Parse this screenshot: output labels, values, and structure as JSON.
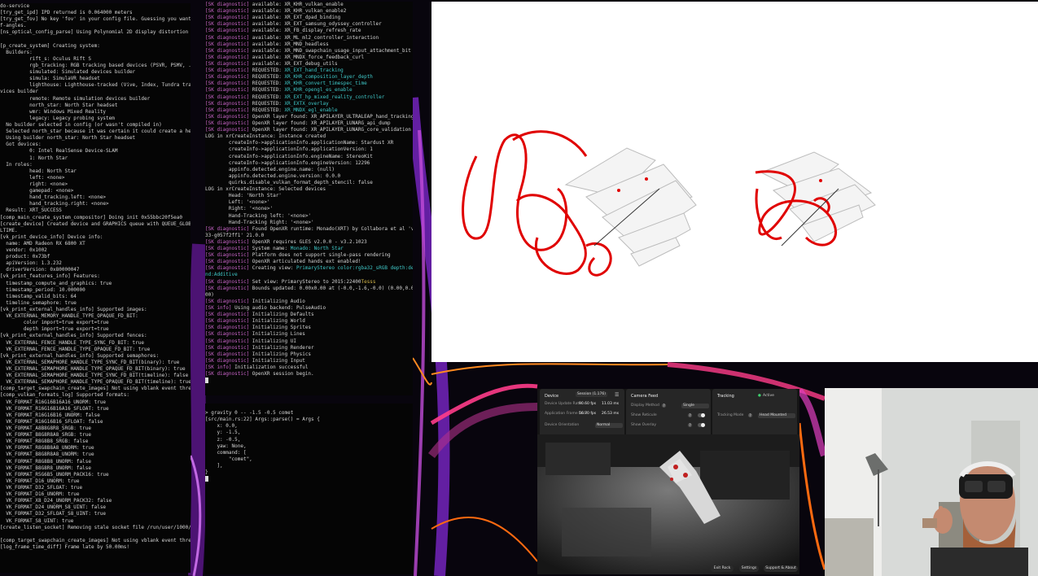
{
  "terminal_left": {
    "lines": [
      "do-service",
      "[try_get_ipd] IPD returned is 0.064000 meters",
      "[try_get_fov] No key 'fov' in your config file. Guessing you want 0.7 radi",
      "f-angles.",
      "[ns_optical_config_parse] Using Polynomial 2D display distortion correctio",
      "",
      "[p_create_system] Creating system:",
      "  Builders:",
      "          rift_s: Oculus Rift S",
      "          rgb_tracking: RGB tracking based devices (PSVR, PSMV, ...)",
      "          simulated: Simulated devices builder",
      "          simula: SimulaVR headset",
      "          lighthouse: Lighthouse-tracked (Vive, Index, Tundra trackers, et",
      "vices builder",
      "          remote: Remote simulation devices builder",
      "          north_star: North Star headset",
      "          wmr: Windows Mixed Reality",
      "          legacy: Legacy probing system",
      "  No builder selected in config (or wasn't compiled in)",
      "  Selected north_star because it was certain it could create a head",
      "  Using builder north_star: North Star headset",
      "  Got devices:",
      "          0: Intel RealSense Device-SLAM",
      "          1: North Star",
      "  In roles:",
      "          head: North Star",
      "          left: <none>",
      "          right: <none>",
      "          gamepad: <none>",
      "          hand_tracking.left: <none>",
      "          hand_tracking.right: <none>",
      "  Result: XRT_SUCCESS",
      "[comp_main_create_system_compositor] Doing init 0x55bbc20f5ea0",
      "[create_device] Created device and GRAPHICS queue with QUEUE_GLOBAL_PRIORI",
      "LTIME.",
      "[vk_print_device_info] Device info:",
      "  name: AMD Radeon RX 6800 XT",
      "  vendor: 0x1002",
      "  product: 0x73bf",
      "  apiVersion: 1.3.232",
      "  driverVersion: 0x80000047",
      "[vk_print_features_info] Features:",
      "  timestamp_compute_and_graphics: true",
      "  timestamp_period: 10.000000",
      "  timestamp_valid_bits: 64",
      "  timeline_semaphore: true",
      "[vk_print_external_handles_info] Supported images:",
      "  VK_EXTERNAL_MEMORY_HANDLE_TYPE_OPAQUE_FD_BIT:",
      "        color import=true export=true",
      "        depth import=true export=true",
      "[vk_print_external_handles_info] Supported fences:",
      "  VK_EXTERNAL_FENCE_HANDLE_TYPE_SYNC_FD_BIT: true",
      "  VK_EXTERNAL_FENCE_HANDLE_TYPE_OPAQUE_FD_BIT: true",
      "[vk_print_external_handles_info] Supported semaphores:",
      "  VK_EXTERNAL_SEMAPHORE_HANDLE_TYPE_SYNC_FD_BIT(binary): true",
      "  VK_EXTERNAL_SEMAPHORE_HANDLE_TYPE_OPAQUE_FD_BIT(binary): true",
      "  VK_EXTERNAL_SEMAPHORE_HANDLE_TYPE_SYNC_FD_BIT(timeline): false",
      "  VK_EXTERNAL_SEMAPHORE_HANDLE_TYPE_OPAQUE_FD_BIT(timeline): true",
      "[comp_target_swapchain_create_images] Not using vblank event thread!",
      "[comp_vulkan_formats_log] Supported formats:",
      "  VK_FORMAT_R16G16B16A16_UNORM: true",
      "  VK_FORMAT_R16G16B16A16_SFLOAT: true",
      "  VK_FORMAT_R16G16B16_UNORM: false",
      "  VK_FORMAT_R16G16B16_SFLOAT: false",
      "  VK_FORMAT_A8B8G8R8_SRGB: true",
      "  VK_FORMAT_B8G8R8A8_SRGB: true",
      "  VK_FORMAT_R8G8B8_SRGB: false",
      "  VK_FORMAT_R8G8B8A8_UNORM: true",
      "  VK_FORMAT_B8G8R8A8_UNORM: true",
      "  VK_FORMAT_R8G8B8_UNORM: false",
      "  VK_FORMAT_B8G8R8_UNORM: false",
      "  VK_FORMAT_R5G6B5_UNORM_PACK16: true",
      "  VK_FORMAT_D16_UNORM: true",
      "  VK_FORMAT_D32_SFLOAT: true",
      "  VK_FORMAT_D16_UNORM: true",
      "  VK_FORMAT_X8_D24_UNORM_PACK32: false",
      "  VK_FORMAT_D24_UNORM_S8_UINT: false",
      "  VK_FORMAT_D32_SFLOAT_S8_UINT: true",
      "  VK_FORMAT_S8_UINT: true",
      "[create_listen_socket] Removing stale socket file /run/user/1000/monado_co",
      "",
      "[comp_target_swapchain_create_images] Not using vblank event thread!",
      "[log_frame_time_diff] Frame late by 50.00ms!"
    ]
  },
  "terminal_mid": {
    "lines": [
      {
        "tag": "[SK diagnostic]",
        "text": " available: XR_KHR_vulkan_enable"
      },
      {
        "tag": "[SK diagnostic]",
        "text": " available: XR_KHR_vulkan_enable2"
      },
      {
        "tag": "[SK diagnostic]",
        "text": " available: XR_EXT_dpad_binding"
      },
      {
        "tag": "[SK diagnostic]",
        "text": " available: XR_EXT_samsung_odyssey_controller"
      },
      {
        "tag": "[SK diagnostic]",
        "text": " available: XR_FB_display_refresh_rate"
      },
      {
        "tag": "[SK diagnostic]",
        "text": " available: XR_ML_ml2_controller_interaction"
      },
      {
        "tag": "[SK diagnostic]",
        "text": " available: XR_MND_headless"
      },
      {
        "tag": "[SK diagnostic]",
        "text": " available: XR_MND_swapchain_usage_input_attachment_bit"
      },
      {
        "tag": "[SK diagnostic]",
        "text": " available: XR_MNDX_force_feedback_curl"
      },
      {
        "tag": "[SK diagnostic]",
        "text": " available: XR_EXT_debug_utils"
      },
      {
        "tag": "[SK diagnostic]",
        "text": " REQUESTED: ",
        "hl": "XR_EXT_hand_tracking"
      },
      {
        "tag": "[SK diagnostic]",
        "text": " REQUESTED: ",
        "hl": "XR_KHR_composition_layer_depth"
      },
      {
        "tag": "[SK diagnostic]",
        "text": " REQUESTED: ",
        "hl": "XR_KHR_convert_timespec_time"
      },
      {
        "tag": "[SK diagnostic]",
        "text": " REQUESTED: ",
        "hl": "XR_KHR_opengl_es_enable"
      },
      {
        "tag": "[SK diagnostic]",
        "text": " REQUESTED: ",
        "hl": "XR_EXT_hp_mixed_reality_controller"
      },
      {
        "tag": "[SK diagnostic]",
        "text": " REQUESTED: ",
        "hl": "XR_EXTX_overlay"
      },
      {
        "tag": "[SK diagnostic]",
        "text": " REQUESTED: ",
        "hl": "XR_MNDX_egl_enable"
      },
      {
        "tag": "[SK diagnostic]",
        "text": " OpenXR layer found: XR_APILAYER_ULTRALEAP_hand_tracking"
      },
      {
        "tag": "[SK diagnostic]",
        "text": " OpenXR layer found: XR_APILAYER_LUNARG_api_dump"
      },
      {
        "tag": "[SK diagnostic]",
        "text": " OpenXR layer found: XR_APILAYER_LUNARG_core_validation"
      },
      {
        "tag": "",
        "text": "LOG in xrCreateInstance: Instance created"
      },
      {
        "tag": "",
        "text": "        createInfo->applicationInfo.applicationName: Stardust XR"
      },
      {
        "tag": "",
        "text": "        createInfo->applicationInfo.applicationVersion: 1"
      },
      {
        "tag": "",
        "text": "        createInfo->applicationInfo.engineName: StereoKit"
      },
      {
        "tag": "",
        "text": "        createInfo->applicationInfo.engineVersion: 12296"
      },
      {
        "tag": "",
        "text": "        appinfo.detected.engine.name: (null)"
      },
      {
        "tag": "",
        "text": "        appinfo.detected.engine.version: 0.0.0"
      },
      {
        "tag": "",
        "text": "        quirks.disable_vulkan_format_depth_stencil: false"
      },
      {
        "tag": "",
        "text": "LOG in xrCreateInstance: Selected devices"
      },
      {
        "tag": "",
        "text": "        Head: 'North Star'"
      },
      {
        "tag": "",
        "text": "        Left: '<none>'"
      },
      {
        "tag": "",
        "text": "        Right: '<none>'"
      },
      {
        "tag": "",
        "text": "        Hand-Tracking left: '<none>'"
      },
      {
        "tag": "",
        "text": "        Hand-Tracking Right: '<none>'"
      },
      {
        "tag": "[SK diagnostic]",
        "text": " Found OpenXR runtime: Monado(XRT) by Collabora et al 'v21.0.0-31"
      },
      {
        "tag": "",
        "text": "33-g057f2ff1' 21.0.0"
      },
      {
        "tag": "[SK diagnostic]",
        "text": " OpenXR requires GLES v2.0.0 - v3.2.1023"
      },
      {
        "tag": "[SK diagnostic]",
        "text": " System name: ",
        "hl": "Monado: North Star"
      },
      {
        "tag": "[SK diagnostic]",
        "text": " Platform does not support single-pass rendering"
      },
      {
        "tag": "[SK diagnostic]",
        "text": " OpenXR articulated hands ext enabled!"
      },
      {
        "tag": "[SK diagnostic]",
        "text": " Creating view: ",
        "hl": "PrimaryStereo color:rgba32_sRGB depth:depth32 ble"
      },
      {
        "tag": "",
        "hl": "nd:Additive"
      },
      {
        "tag": "[SK diagnostic]",
        "text": " Set view: PrimaryStereo to 2015:22400",
        "sel": "Tesss"
      },
      {
        "tag": "[SK diagnostic]",
        "text": " Bounds updated: 0.00x0.00 at (-0.0,-1.6,-0.0) (0.00,0.00,0.00,1."
      },
      {
        "tag": "",
        "text": "00)"
      },
      {
        "tag": "[SK diagnostic]",
        "text": " Initializing Audio"
      },
      {
        "tag": "[SK info]",
        "text": " Using audio backend: PulseAudio"
      },
      {
        "tag": "[SK diagnostic]",
        "text": " Initializing Defaults"
      },
      {
        "tag": "[SK diagnostic]",
        "text": " Initializing World"
      },
      {
        "tag": "[SK diagnostic]",
        "text": " Initializing Sprites"
      },
      {
        "tag": "[SK diagnostic]",
        "text": " Initializing Lines"
      },
      {
        "tag": "[SK diagnostic]",
        "text": " Initializing UI"
      },
      {
        "tag": "[SK diagnostic]",
        "text": " Initializing Renderer"
      },
      {
        "tag": "[SK diagnostic]",
        "text": " Initializing Physics"
      },
      {
        "tag": "[SK diagnostic]",
        "text": " Initializing Input"
      },
      {
        "tag": "[SK info]",
        "text": " Initialization successful"
      },
      {
        "tag": "[SK diagnostic]",
        "text": " OpenXR session begin."
      }
    ]
  },
  "terminal_mid_bottom": {
    "lines": [
      "> gravity 0 -- -1.5 -0.5 comet",
      "[src/main.rs:22] Args::parse() = Args {",
      "    x: 0.0,",
      "    y: -1.5,",
      "    z: -0.5,",
      "    yaw: None,",
      "    command: [",
      "        \"comet\",",
      "    ],",
      "}"
    ]
  },
  "monitor": {
    "device": {
      "title": "Device",
      "session_label": "Session (1.176)",
      "row1_label": "Device Update Rate",
      "row1_val1": "90.60 fps",
      "row1_val2": "11.03 ms",
      "row2_label": "Application Frame Rate",
      "row2_val1": "56.70 fps",
      "row2_val2": "26.53 ms",
      "row3_label": "Device Orientation",
      "row3_select": "Normal"
    },
    "camera": {
      "title": "Camera Feed",
      "row1_label": "Display Method",
      "row1_select": "Single",
      "row2_label": "Show Reticule",
      "row3_label": "Show Overlay"
    },
    "tracking": {
      "title": "Tracking",
      "status": "Active",
      "row1_label": "Tracking Mode",
      "row1_select": "Head Mounted"
    },
    "buttons": [
      "Exit Rock",
      "Settings",
      "Support & About"
    ]
  },
  "colors": {
    "tag": "#c864c8",
    "highlight": "#3fc8c8",
    "active_green": "#3ecf6e",
    "hand_red": "#e00000"
  }
}
